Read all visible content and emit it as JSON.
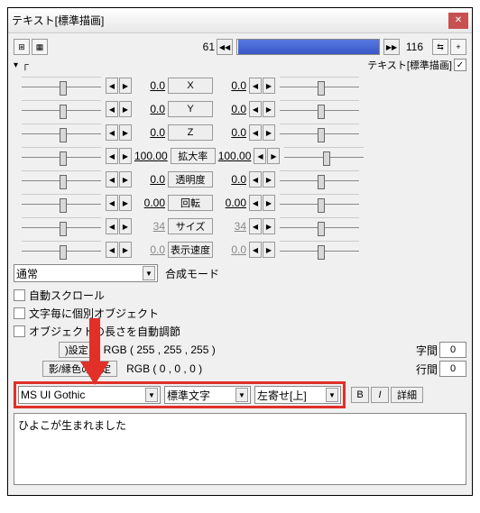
{
  "title": "テキスト[標準描画]",
  "top": {
    "start": "61",
    "end": "116",
    "grouplabel": "テキスト[標準描画]"
  },
  "tree": "┌",
  "params": [
    {
      "name": "X",
      "left": "0.0",
      "right": "0.0"
    },
    {
      "name": "Y",
      "left": "0.0",
      "right": "0.0"
    },
    {
      "name": "Z",
      "left": "0.0",
      "right": "0.0"
    },
    {
      "name": "拡大率",
      "left": "100.00",
      "right": "100.00"
    },
    {
      "name": "透明度",
      "left": "0.0",
      "right": "0.0"
    },
    {
      "name": "回転",
      "left": "0.00",
      "right": "0.00"
    },
    {
      "name": "サイズ",
      "left": "34",
      "right": "34",
      "gray": true
    },
    {
      "name": "表示速度",
      "left": "0.0",
      "right": "0.0",
      "gray": true
    }
  ],
  "blend": {
    "label": "合成モード",
    "value": "通常"
  },
  "checks": [
    "自動スクロール",
    "文字毎に個別オブジェクト",
    "オブジェクトの長さを自動調節"
  ],
  "color1": {
    "btn": ")設定",
    "text": "RGB ( 255 , 255 , 255 )"
  },
  "color2": {
    "btn": "影/縁色の設定",
    "text": "RGB ( 0 , 0 , 0 )"
  },
  "spacing": {
    "char_label": "字間",
    "char_val": "0",
    "line_label": "行間",
    "line_val": "0"
  },
  "font": {
    "name": "MS UI Gothic",
    "style": "標準文字",
    "align": "左寄せ[上]"
  },
  "btns": {
    "b": "B",
    "i": "I",
    "detail": "詳細"
  },
  "text": "ひよこが生まれました"
}
